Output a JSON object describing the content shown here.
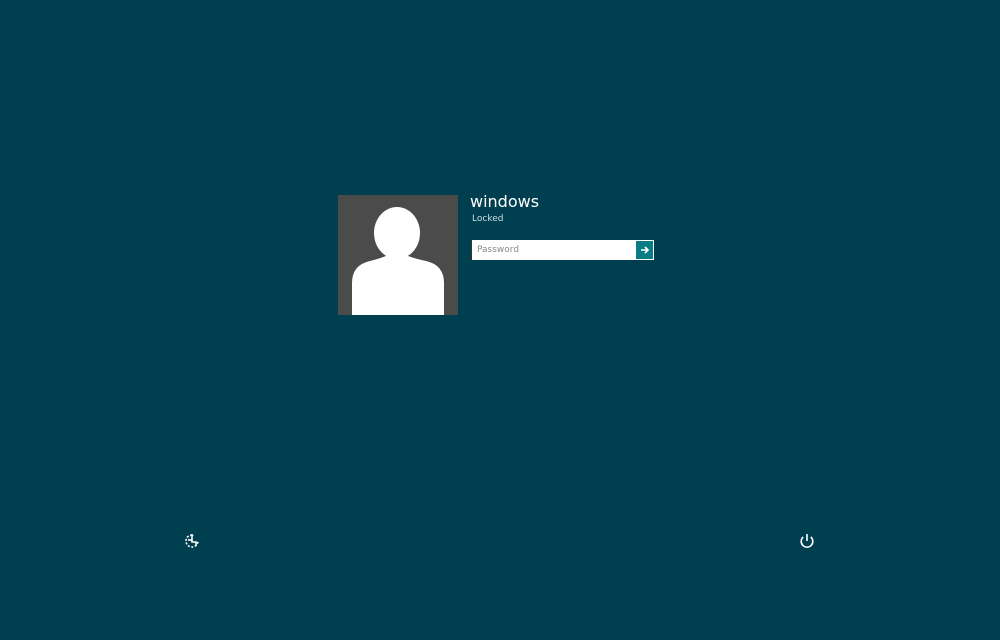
{
  "user": {
    "name": "windows",
    "status": "Locked"
  },
  "password_field": {
    "placeholder": "Password",
    "value": ""
  },
  "icons": {
    "avatar": "user-silhouette-icon",
    "submit": "arrow-right-icon",
    "ease_of_access": "ease-of-access-icon",
    "power": "power-icon"
  },
  "colors": {
    "background": "#003f50",
    "avatar_tile": "#4b4b4b",
    "submit_button": "#0c7c84",
    "text": "#ffffff"
  }
}
